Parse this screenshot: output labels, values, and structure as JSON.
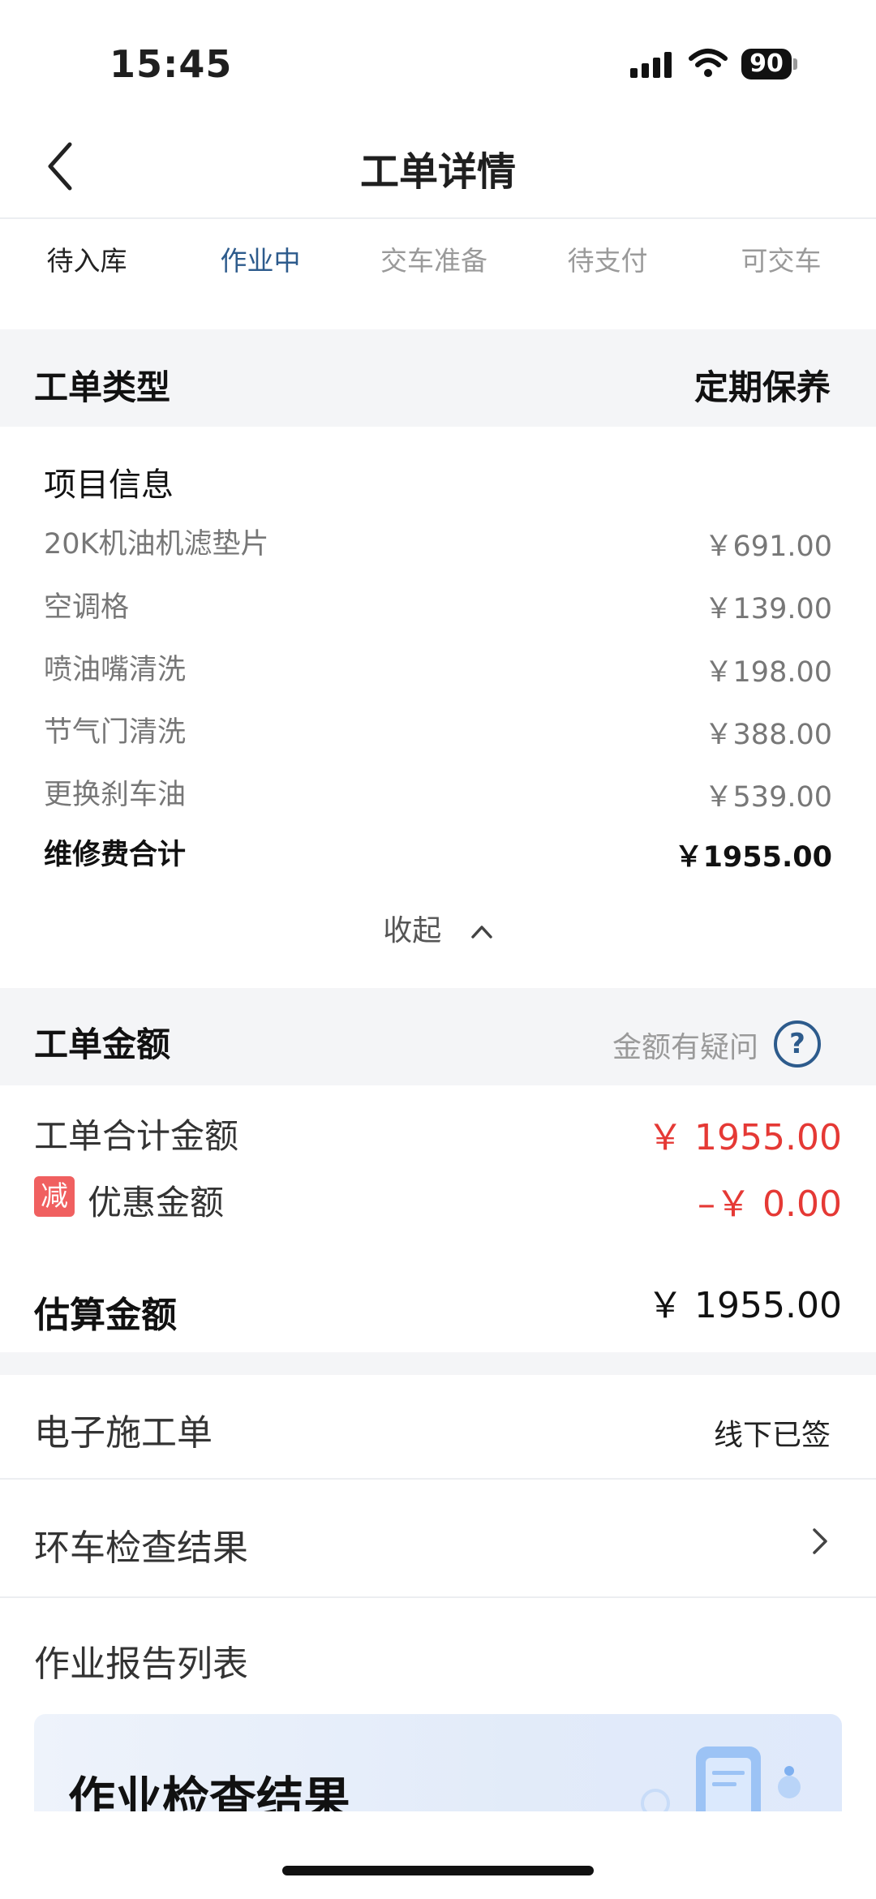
{
  "status_bar": {
    "time": "15:45",
    "battery": "90"
  },
  "nav": {
    "title": "工单详情"
  },
  "steps": [
    {
      "label": "待入库",
      "state": "done"
    },
    {
      "label": "作业中",
      "state": "active"
    },
    {
      "label": "交车准备",
      "state": "pending"
    },
    {
      "label": "待支付",
      "state": "pending"
    },
    {
      "label": "可交车",
      "state": "pending"
    }
  ],
  "order_type": {
    "label": "工单类型",
    "value": "定期保养"
  },
  "project": {
    "title": "项目信息",
    "items": [
      {
        "name": "20K机油机滤垫片",
        "price": "￥691.00"
      },
      {
        "name": "空调格",
        "price": "￥139.00"
      },
      {
        "name": "喷油嘴清洗",
        "price": "￥198.00"
      },
      {
        "name": "节气门清洗",
        "price": "￥388.00"
      },
      {
        "name": "更换刹车油",
        "price": "￥539.00"
      }
    ],
    "total_label": "维修费合计",
    "total_value": "￥1955.00",
    "collapse_label": "收起"
  },
  "amount": {
    "title": "工单金额",
    "question_label": "金额有疑问",
    "total_label": "工单合计金额",
    "total_value": "￥ 1955.00",
    "discount_badge": "减",
    "discount_label": "优惠金额",
    "discount_value": "–￥ 0.00",
    "estimate_label": "估算金额",
    "estimate_value": "￥ 1955.00"
  },
  "rows": {
    "e_order_label": "电子施工单",
    "e_order_value": "线下已签",
    "inspection_label": "环车检查结果",
    "report_label": "作业报告列表"
  },
  "banner": {
    "title": "作业检查结果"
  },
  "colors": {
    "accent": "#2d5b8c",
    "red": "#e53935",
    "band": "#f4f5f7"
  }
}
